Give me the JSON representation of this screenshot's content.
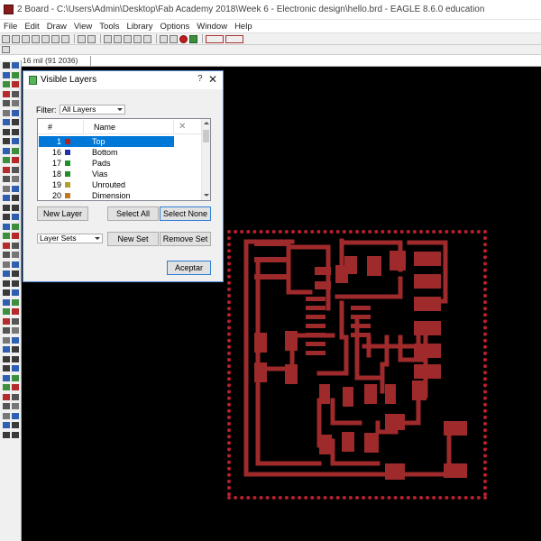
{
  "window": {
    "title": "2 Board - C:\\Users\\Admin\\Desktop\\Fab Academy 2018\\Week 6 - Electronic design\\hello.brd - EAGLE 8.6.0 education"
  },
  "menu": [
    "File",
    "Edit",
    "Draw",
    "View",
    "Tools",
    "Library",
    "Options",
    "Window",
    "Help"
  ],
  "coordinates": "16 mil (91 2036)",
  "dialog": {
    "title": "Visible Layers",
    "help": "?",
    "close": "✕",
    "filter_label": "Filter:",
    "filter_value": "All Layers",
    "columns": {
      "num": "#",
      "name": "Name",
      "x": "✕"
    },
    "layers": [
      {
        "num": "1",
        "name": "Top",
        "color": "#b2231f",
        "selected": true
      },
      {
        "num": "16",
        "name": "Bottom",
        "color": "#1f2fb0"
      },
      {
        "num": "17",
        "name": "Pads",
        "color": "#1f8f2a"
      },
      {
        "num": "18",
        "name": "Vias",
        "color": "#1f8f2a"
      },
      {
        "num": "19",
        "name": "Unrouted",
        "color": "#b0a02a"
      },
      {
        "num": "20",
        "name": "Dimension",
        "color": "#c07a1a"
      }
    ],
    "buttons": {
      "new_layer": "New Layer",
      "select_all": "Select All",
      "select_none": "Select None",
      "layer_sets": "Layer Sets",
      "new_set": "New Set",
      "remove_set": "Remove Set",
      "accept": "Aceptar"
    }
  },
  "colors": {
    "canvas": "#000000",
    "copper": "#9e2a2b",
    "outline_dots": "#b8202a",
    "selection": "#0078d7"
  }
}
